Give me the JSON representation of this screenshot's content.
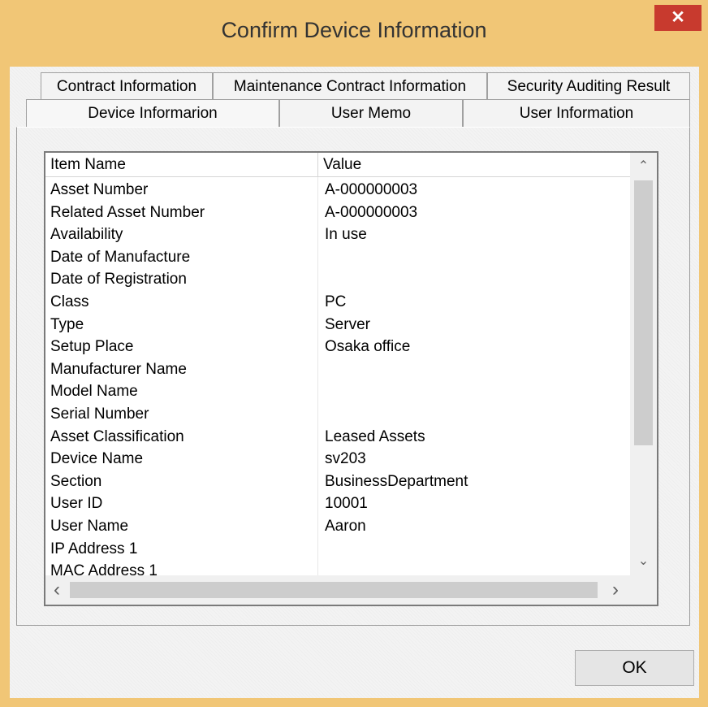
{
  "window": {
    "title": "Confirm Device Information",
    "close_glyph": "✕",
    "accent_color": "#f1c676",
    "close_color": "#c83a2e"
  },
  "tabs": {
    "row1": [
      {
        "label": "Contract Information"
      },
      {
        "label": "Maintenance Contract Information"
      },
      {
        "label": "Security Auditing Result"
      }
    ],
    "row2": [
      {
        "label": "Device Informarion",
        "selected": true
      },
      {
        "label": "User Memo"
      },
      {
        "label": "User Information"
      }
    ]
  },
  "table": {
    "columns": [
      "Item Name",
      "Value"
    ],
    "rows": [
      [
        "Asset Number",
        "A-000000003"
      ],
      [
        "Related Asset Number",
        "A-000000003"
      ],
      [
        "Availability",
        "In use"
      ],
      [
        "Date of Manufacture",
        ""
      ],
      [
        "Date of Registration",
        ""
      ],
      [
        "Class",
        "PC"
      ],
      [
        "Type",
        "Server"
      ],
      [
        "Setup Place",
        "Osaka office"
      ],
      [
        "Manufacturer Name",
        ""
      ],
      [
        "Model Name",
        ""
      ],
      [
        "Serial Number",
        ""
      ],
      [
        "Asset Classification",
        "Leased Assets"
      ],
      [
        "Device Name",
        "sv203"
      ],
      [
        "Section",
        "BusinessDepartment"
      ],
      [
        "User ID",
        "10001"
      ],
      [
        "User Name",
        "Aaron"
      ],
      [
        "IP Address 1",
        ""
      ],
      [
        "MAC Address 1",
        ""
      ]
    ]
  },
  "scrollbar": {
    "up_glyph": "⌃",
    "down_glyph": "⌄",
    "left_glyph": "‹",
    "right_glyph": "›"
  },
  "footer": {
    "ok_label": "OK"
  }
}
